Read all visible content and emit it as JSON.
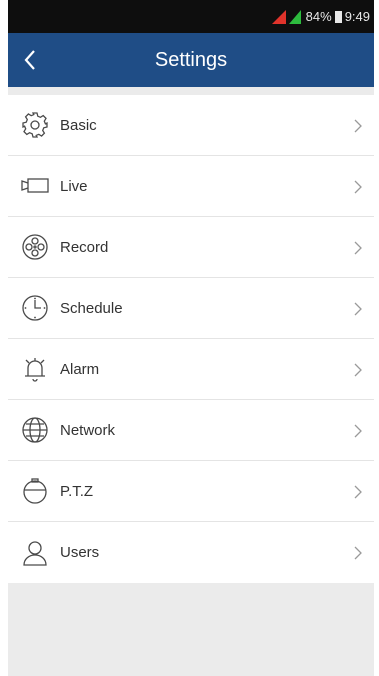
{
  "status_bar": {
    "battery": "84%",
    "time": "9:49"
  },
  "header": {
    "title": "Settings"
  },
  "menu": [
    {
      "label": "Basic"
    },
    {
      "label": "Live"
    },
    {
      "label": "Record"
    },
    {
      "label": "Schedule"
    },
    {
      "label": "Alarm"
    },
    {
      "label": "Network"
    },
    {
      "label": "P.T.Z"
    },
    {
      "label": "Users"
    }
  ],
  "colors": {
    "header": "#1f4d86",
    "status_bar": "#0e0e0e",
    "background": "#ebebeb",
    "icon": "#4a4a4a"
  },
  "icons": [
    "back-icon",
    "gear-icon",
    "camera-icon",
    "film-reel-icon",
    "clock-icon",
    "bell-icon",
    "globe-icon",
    "ptz-dome-icon",
    "user-icon",
    "chevron-right-icon"
  ]
}
